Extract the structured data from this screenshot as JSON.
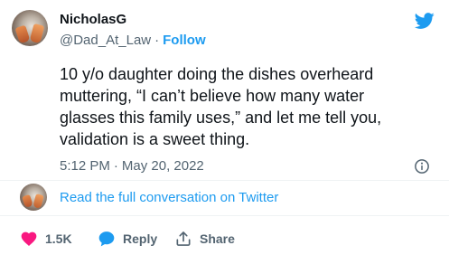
{
  "author": {
    "name": "NicholasG",
    "handle": "@Dad_At_Law",
    "follow_label": "Follow"
  },
  "tweet": {
    "text": "10 y/o daughter doing the dishes overheard\nmuttering, “I can’t believe how many water\nglasses this family uses,” and let me tell you,\nvalidation is a sweet thing.",
    "time": "5:12 PM",
    "date": "May 20, 2022"
  },
  "conversation_link": "Read the full conversation on Twitter",
  "actions": {
    "like_count": "1.5K",
    "reply_label": "Reply",
    "share_label": "Share"
  },
  "colors": {
    "accent": "#1d9bf0",
    "like": "#f91880",
    "muted": "#536471"
  },
  "icons": [
    "twitter-bird-icon",
    "info-icon",
    "heart-icon",
    "reply-bubble-icon",
    "share-icon"
  ]
}
